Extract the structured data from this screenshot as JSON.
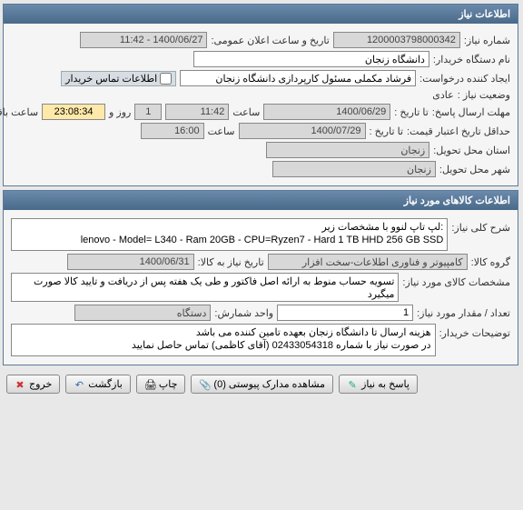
{
  "panel1": {
    "title": "اطلاعات نیاز",
    "need_no_label": "شماره نیاز:",
    "need_no": "1200003798000342",
    "announce_label": "تاریخ و ساعت اعلان عمومی:",
    "announce_datetime": "1400/06/27 - 11:42",
    "buyer_label": "نام دستگاه خریدار:",
    "buyer": "دانشگاه زنجان",
    "creator_label": "ایجاد کننده درخواست:",
    "creator": "فرشاد مکملی مسئول کارپردازی دانشگاه زنجان",
    "contact_checkbox": "اطلاعات تماس خریدار",
    "status_label": "وضعیت نیاز :",
    "status": "عادی",
    "deadline_label": "مهلت ارسال پاسخ:",
    "deadline_date_label": "تا تاریخ :",
    "deadline_date": "1400/06/29",
    "deadline_time_label": "ساعت",
    "deadline_time": "11:42",
    "remaining_day": "1",
    "remaining_day_label": "روز و",
    "remaining_time": "23:08:34",
    "remaining_suffix": "ساعت باقی مانده",
    "min_validity_label": "حداقل تاریخ اعتبار قیمت:",
    "min_validity_date_label": "تا تاریخ :",
    "min_validity_date": "1400/07/29",
    "min_validity_time_label": "ساعت",
    "min_validity_time": "16:00",
    "province_label": "استان محل تحویل:",
    "province": "زنجان",
    "city_label": "شهر محل تحویل:",
    "city": "زنجان"
  },
  "panel2": {
    "title": "اطلاعات کالاهای مورد نیاز",
    "desc_label": "شرح کلی نیاز:",
    "desc": "لپ تاپ لنوو با مشخصات زیر:\nlenovo - Model= L340 - Ram 20GB - CPU=Ryzen7 - Hard 1 TB HHD 256 GB SSD",
    "group_label": "گروه کالا:",
    "group": "کامپیوتر و فناوری اطلاعات-سخت افزار",
    "need_until_label": "تاریخ نیاز به کالا:",
    "need_until": "1400/06/31",
    "spec_label": "مشخصات کالای مورد نیاز:",
    "spec": "تسویه حساب منوط به ارائه اصل فاکتور و طی یک هفته پس از دریافت و تایید کالا صورت میگیرد",
    "qty_label": "تعداد / مقدار مورد نیاز:",
    "qty": "1",
    "unit_label": "واحد شمارش:",
    "unit": "دستگاه",
    "notes_label": "توضیحات خریدار:",
    "notes": "هزینه ارسال تا دانشگاه زنجان بعهده تامین کننده می باشد\nدر صورت نیاز با شماره 02433054318 (آقای کاظمی) تماس حاصل نمایید"
  },
  "buttons": {
    "exit": "خروج",
    "back": "بازگشت",
    "print": "چاپ",
    "attachments": "مشاهده مدارک پیوستی (0)",
    "reply": "پاسخ به نیاز"
  },
  "icons": {
    "exit": "✖",
    "back": "↶",
    "print": "🖨",
    "attach": "📎",
    "reply": "✎"
  }
}
